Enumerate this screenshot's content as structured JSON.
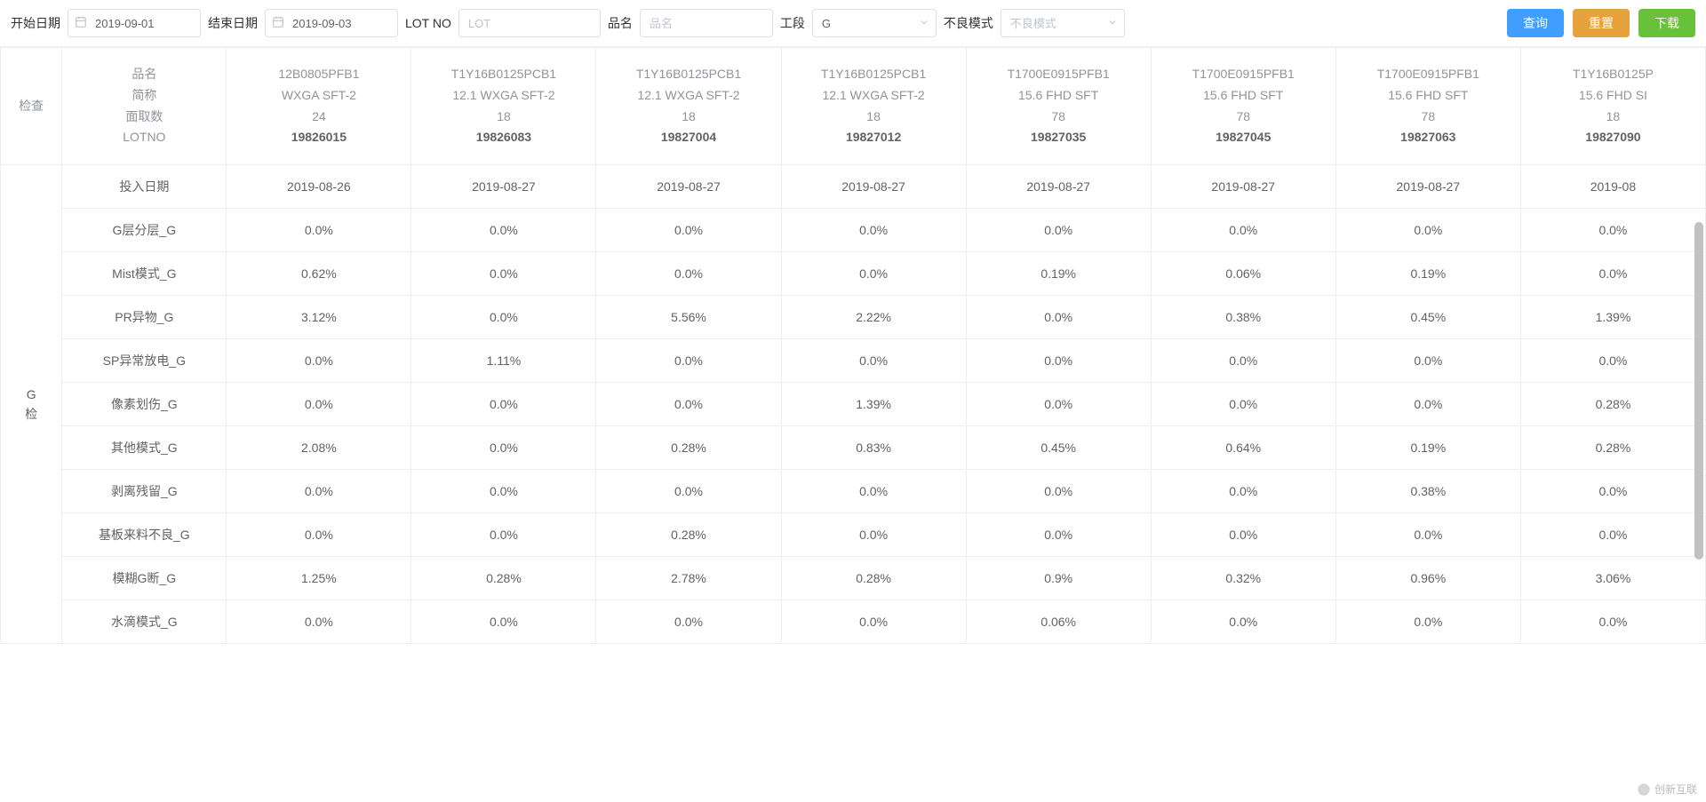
{
  "toolbar": {
    "start_date_label": "开始日期",
    "start_date_value": "2019-09-01",
    "end_date_label": "结束日期",
    "end_date_value": "2019-09-03",
    "lotno_label": "LOT NO",
    "lotno_placeholder": "LOT",
    "product_label": "品名",
    "product_placeholder": "品名",
    "process_label": "工段",
    "process_value": "G",
    "defect_mode_label": "不良模式",
    "defect_mode_placeholder": "不良模式",
    "query_btn": "查询",
    "reset_btn": "重置",
    "download_btn": "下载"
  },
  "header": {
    "check_label": "检查",
    "row_labels": [
      "品名",
      "简称",
      "面取数",
      "LOTNO"
    ],
    "columns": [
      {
        "product": "12B0805PFB1",
        "short": "WXGA SFT-2",
        "qty": "24",
        "lot": "19826015"
      },
      {
        "product": "T1Y16B0125PCB1",
        "short": "12.1 WXGA SFT-2",
        "qty": "18",
        "lot": "19826083"
      },
      {
        "product": "T1Y16B0125PCB1",
        "short": "12.1 WXGA SFT-2",
        "qty": "18",
        "lot": "19827004"
      },
      {
        "product": "T1Y16B0125PCB1",
        "short": "12.1 WXGA SFT-2",
        "qty": "18",
        "lot": "19827012"
      },
      {
        "product": "T1700E0915PFB1",
        "short": "15.6 FHD SFT",
        "qty": "78",
        "lot": "19827035"
      },
      {
        "product": "T1700E0915PFB1",
        "short": "15.6 FHD SFT",
        "qty": "78",
        "lot": "19827045"
      },
      {
        "product": "T1700E0915PFB1",
        "short": "15.6 FHD SFT",
        "qty": "78",
        "lot": "19827063"
      },
      {
        "product": "T1Y16B0125P",
        "short": "15.6 FHD SI",
        "qty": "18",
        "lot": "19827090"
      }
    ]
  },
  "body": {
    "group_label_line1": "G",
    "group_label_line2": "检",
    "rows": [
      {
        "label": "投入日期",
        "cells": [
          "2019-08-26",
          "2019-08-27",
          "2019-08-27",
          "2019-08-27",
          "2019-08-27",
          "2019-08-27",
          "2019-08-27",
          "2019-08"
        ]
      },
      {
        "label": "G层分层_G",
        "cells": [
          "0.0%",
          "0.0%",
          "0.0%",
          "0.0%",
          "0.0%",
          "0.0%",
          "0.0%",
          "0.0%"
        ]
      },
      {
        "label": "Mist模式_G",
        "cells": [
          "0.62%",
          "0.0%",
          "0.0%",
          "0.0%",
          "0.19%",
          "0.06%",
          "0.19%",
          "0.0%"
        ]
      },
      {
        "label": "PR异物_G",
        "cells": [
          "3.12%",
          "0.0%",
          "5.56%",
          "2.22%",
          "0.0%",
          "0.38%",
          "0.45%",
          "1.39%"
        ]
      },
      {
        "label": "SP异常放电_G",
        "cells": [
          "0.0%",
          "1.11%",
          "0.0%",
          "0.0%",
          "0.0%",
          "0.0%",
          "0.0%",
          "0.0%"
        ]
      },
      {
        "label": "像素划伤_G",
        "cells": [
          "0.0%",
          "0.0%",
          "0.0%",
          "1.39%",
          "0.0%",
          "0.0%",
          "0.0%",
          "0.28%"
        ]
      },
      {
        "label": "其他模式_G",
        "cells": [
          "2.08%",
          "0.0%",
          "0.28%",
          "0.83%",
          "0.45%",
          "0.64%",
          "0.19%",
          "0.28%"
        ]
      },
      {
        "label": "剥离残留_G",
        "cells": [
          "0.0%",
          "0.0%",
          "0.0%",
          "0.0%",
          "0.0%",
          "0.0%",
          "0.38%",
          "0.0%"
        ]
      },
      {
        "label": "基板来料不良_G",
        "cells": [
          "0.0%",
          "0.0%",
          "0.28%",
          "0.0%",
          "0.0%",
          "0.0%",
          "0.0%",
          "0.0%"
        ]
      },
      {
        "label": "模糊G断_G",
        "cells": [
          "1.25%",
          "0.28%",
          "2.78%",
          "0.28%",
          "0.9%",
          "0.32%",
          "0.96%",
          "3.06%"
        ]
      },
      {
        "label": "水滴模式_G",
        "cells": [
          "0.0%",
          "0.0%",
          "0.0%",
          "0.0%",
          "0.06%",
          "0.0%",
          "0.0%",
          "0.0%"
        ]
      }
    ]
  },
  "brand": "创新互联"
}
